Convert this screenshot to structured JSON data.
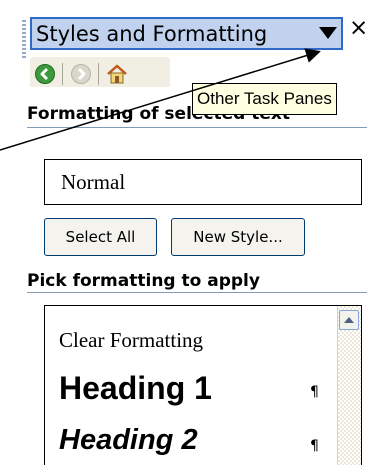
{
  "title_bar": {
    "title": "Styles and Formatting",
    "dropdown_icon": "dropdown-arrow-icon",
    "close": "×"
  },
  "nav": {
    "back_icon": "back-arrow-icon",
    "forward_icon": "forward-arrow-icon",
    "home_icon": "home-icon"
  },
  "tooltip": "Other Task Panes",
  "formatting_section": {
    "heading": "Formatting of selected text",
    "current_style": "Normal",
    "select_all_label": "Select All",
    "new_style_label": "New Style..."
  },
  "pick_section": {
    "heading": "Pick formatting to apply",
    "items": [
      {
        "label": "Clear Formatting",
        "mark": ""
      },
      {
        "label": "Heading 1",
        "mark": "¶"
      },
      {
        "label": "Heading 2",
        "mark": "¶"
      }
    ]
  },
  "colors": {
    "title_bg": "#c1d2ee",
    "title_border": "#3169c6",
    "tooltip_bg": "#ffffe1",
    "nav_back_green": "#3c9a3c"
  }
}
